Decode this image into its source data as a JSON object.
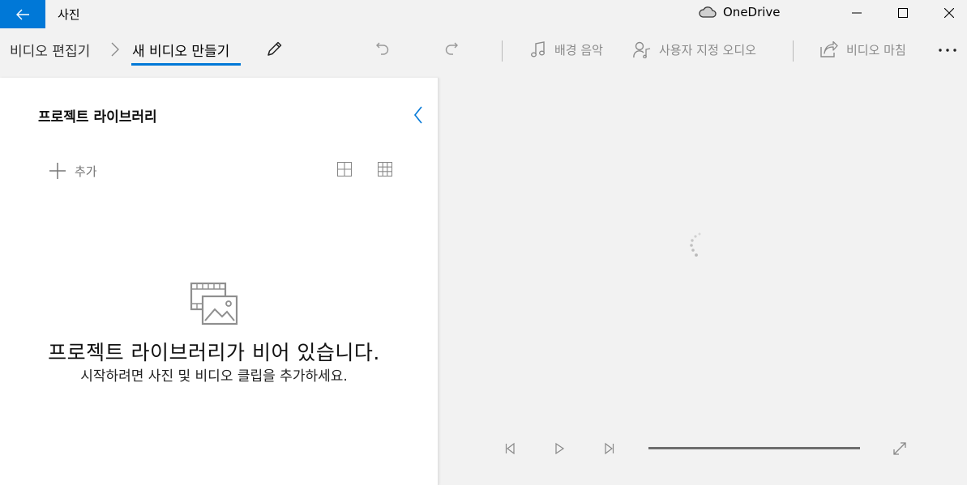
{
  "window": {
    "app_title": "사진",
    "onedrive_label": "OneDrive"
  },
  "breadcrumb": {
    "parent": "비디오 편집기",
    "current": "새 비디오 만들기"
  },
  "toolbar": {
    "background_music": "배경 음악",
    "custom_audio": "사용자 지정 오디오",
    "finish_video": "비디오 마침"
  },
  "library": {
    "title": "프로젝트 라이브러리",
    "add_label": "추가",
    "empty_title": "프로젝트 라이브러리가 비어 있습니다.",
    "empty_subtitle": "시작하려면 사진 및 비디오 클립을 추가하세요."
  },
  "colors": {
    "accent": "#0078d7",
    "background": "#f2f2f2",
    "panel": "#ffffff"
  },
  "player": {
    "progress": 0
  }
}
